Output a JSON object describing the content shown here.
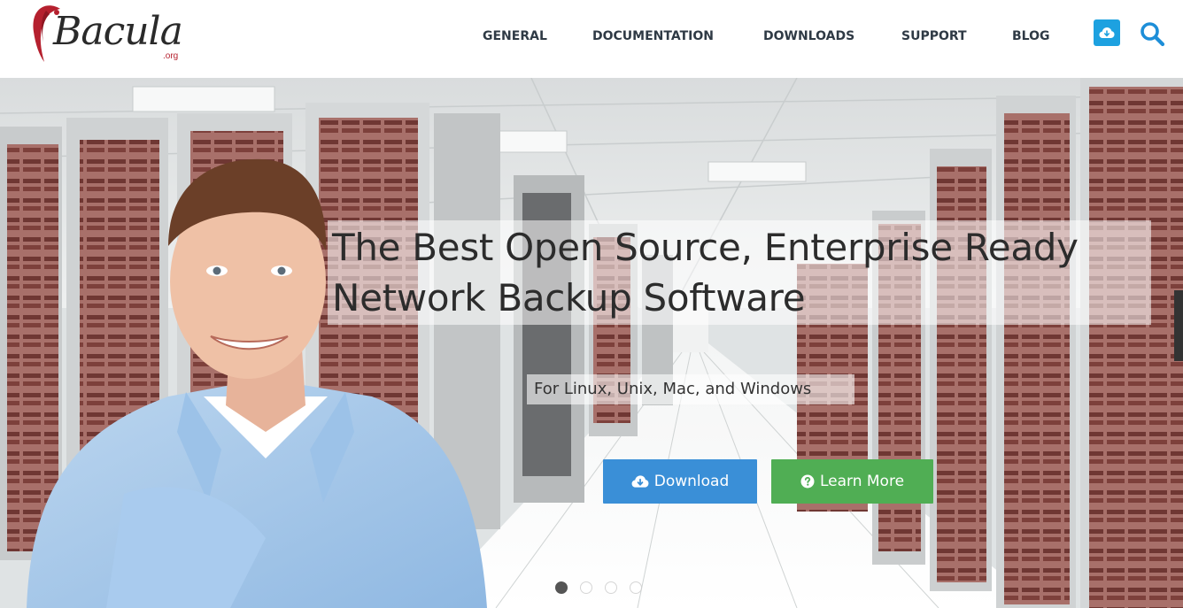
{
  "brand": {
    "name": "Bacula",
    "tld": ".org",
    "accent_color": "#b5202e"
  },
  "nav": {
    "items": [
      {
        "label": "GENERAL"
      },
      {
        "label": "DOCUMENTATION"
      },
      {
        "label": "DOWNLOADS"
      },
      {
        "label": "SUPPORT"
      },
      {
        "label": "BLOG"
      }
    ],
    "cloud_icon": "cloud-download-icon",
    "search_icon": "search-icon"
  },
  "hero": {
    "headline_line1": "The Best Open Source, Enterprise Ready",
    "headline_line2": "Network Backup Software",
    "subheadline": "For Linux, Unix, Mac, and Windows",
    "download_label": "Download",
    "learn_more_label": "Learn More",
    "download_color": "#3a8fd7",
    "learn_more_color": "#50ae54",
    "slides": 4,
    "active_slide": 1
  }
}
